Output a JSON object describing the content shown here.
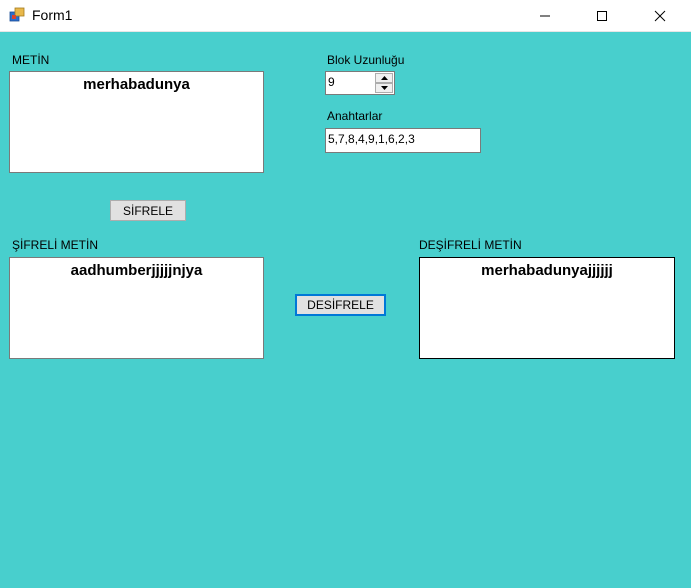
{
  "window": {
    "title": "Form1",
    "client_bg": "#48cfcd"
  },
  "form": {
    "metin_label": "METİN",
    "metin_text": "merhabadunya",
    "block_length_label": "Blok Uzunluğu",
    "block_length_value": "9",
    "keys_label": "Anahtarlar",
    "keys_value": "5,7,8,4,9,1,6,2,3",
    "encrypt_button": "SİFRELE",
    "encrypted_label": "ŞİFRELİ METİN",
    "encrypted_text": "aadhumberjjjjjnjya",
    "decrypt_button": "DESİFRELE",
    "decrypted_label": "DEŞİFRELİ METİN",
    "decrypted_text": "merhabadunyajjjjjj"
  },
  "icons": {
    "app": "app-window-icon",
    "minimize": "minimize-icon",
    "maximize": "maximize-icon",
    "close": "close-icon"
  }
}
